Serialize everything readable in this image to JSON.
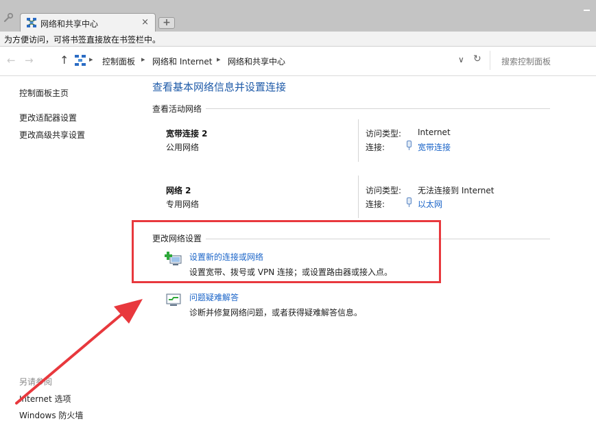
{
  "browser": {
    "tab_title": "网络和共享中心",
    "new_tab_symbol": "+",
    "close_symbol": "×",
    "bookmark_hint": "为方便访问，可将书签直接放在书签栏中。"
  },
  "address_bar": {
    "back_symbol": "←",
    "forward_symbol": "→",
    "up_symbol": "↑",
    "breadcrumbs": [
      "控制面板",
      "网络和 Internet",
      "网络和共享中心"
    ],
    "separator": "▸",
    "dropdown_symbol": "∨",
    "refresh_symbol": "↻",
    "search_placeholder": "搜索控制面板"
  },
  "sidebar": {
    "items": [
      {
        "label": "控制面板主页"
      },
      {
        "label": "更改适配器设置"
      },
      {
        "label": "更改高级共享设置"
      }
    ],
    "see_also_heading": "另请参阅",
    "see_also_items": [
      {
        "label": "Internet 选项"
      },
      {
        "label": "Windows 防火墙"
      }
    ]
  },
  "main": {
    "title": "查看基本网络信息并设置连接",
    "active_networks_heading": "查看活动网络",
    "networks": [
      {
        "name": "宽带连接  2",
        "category": "公用网络",
        "access_label": "访问类型:",
        "access_value": "Internet",
        "connection_label": "连接:",
        "connection_value": "宽带连接"
      },
      {
        "name": "网络  2",
        "category": "专用网络",
        "access_label": "访问类型:",
        "access_value": "无法连接到 Internet",
        "connection_label": "连接:",
        "connection_value": "以太网"
      }
    ],
    "change_settings_heading": "更改网络设置",
    "tasks": [
      {
        "link": "设置新的连接或网络",
        "description": "设置宽带、拨号或 VPN 连接；或设置路由器或接入点。"
      },
      {
        "link": "问题疑难解答",
        "description": "诊断并修复网络问题，或者获得疑难解答信息。"
      }
    ]
  },
  "colors": {
    "annotation_red": "#e8383d",
    "link_blue": "#1a64c8",
    "title_blue": "#1e5aa8"
  }
}
